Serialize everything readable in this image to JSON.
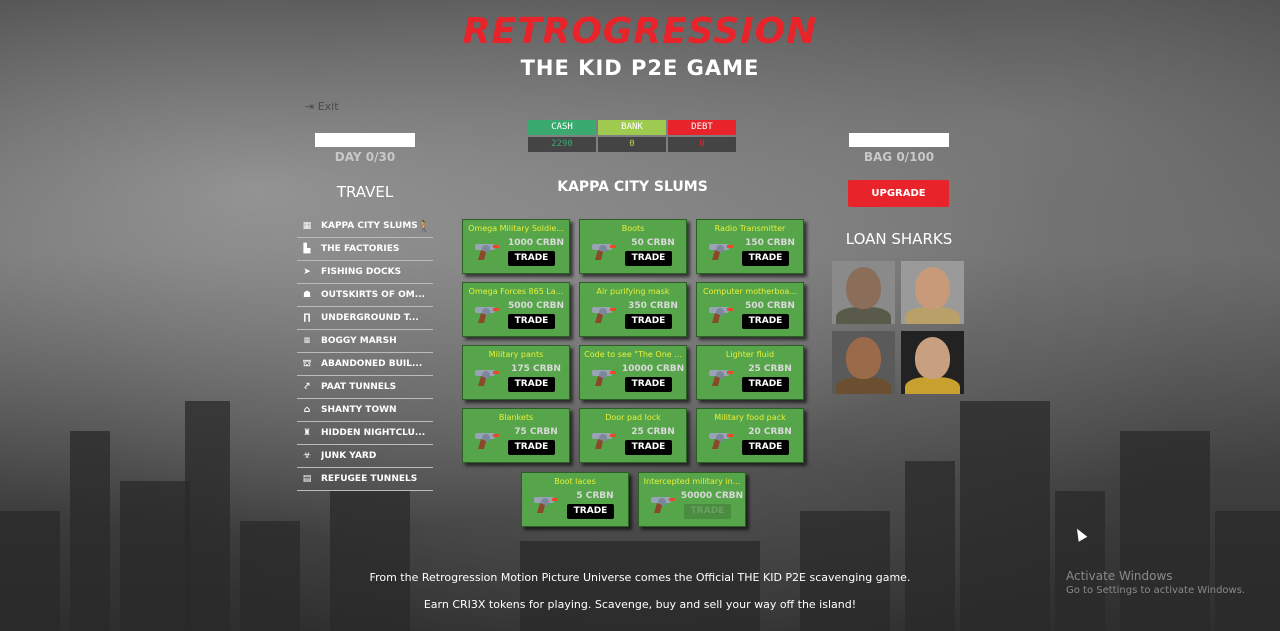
{
  "header": {
    "logo_text": "RETROGRESSION",
    "subtitle": "THE KID P2E GAME"
  },
  "exit_label": "Exit",
  "day": {
    "label": "DAY 0/30",
    "progress": 0
  },
  "bag": {
    "label": "BAG 0/100",
    "progress": 0
  },
  "stats": [
    {
      "label": "CASH",
      "value": "2290",
      "head_color": "#3aaa6e",
      "value_color": "#3aaa6e"
    },
    {
      "label": "BANK",
      "value": "0",
      "head_color": "#9ecb4f",
      "value_color": "#c8d24a"
    },
    {
      "label": "DEBT",
      "value": "0",
      "head_color": "#e8232a",
      "value_color": "#e8232a"
    }
  ],
  "travel": {
    "title": "TRAVEL",
    "items": [
      {
        "label": "KAPPA CITY SLUMS",
        "icon": "building-icon",
        "glyph": "▦",
        "current": true
      },
      {
        "label": "THE FACTORIES",
        "icon": "factory-icon",
        "glyph": "▙",
        "current": false
      },
      {
        "label": "FISHING DOCKS",
        "icon": "fish-icon",
        "glyph": "➤",
        "current": false
      },
      {
        "label": "OUTSKIRTS OF OM...",
        "icon": "people-icon",
        "glyph": "☗",
        "current": false
      },
      {
        "label": "UNDERGROUND T...",
        "icon": "tunnel-icon",
        "glyph": "∏",
        "current": false
      },
      {
        "label": "BOGGY MARSH",
        "icon": "marsh-icon",
        "glyph": "≡",
        "current": false
      },
      {
        "label": "ABANDONED BUIL...",
        "icon": "ruins-icon",
        "glyph": "⛫",
        "current": false
      },
      {
        "label": "PAAT TUNNELS",
        "icon": "route-icon",
        "glyph": "⤤",
        "current": false
      },
      {
        "label": "SHANTY TOWN",
        "icon": "shack-icon",
        "glyph": "⌂",
        "current": false
      },
      {
        "label": "HIDDEN NIGHTCLU...",
        "icon": "cocktail-icon",
        "glyph": "♜",
        "current": false
      },
      {
        "label": "JUNK YARD",
        "icon": "biohazard-icon",
        "glyph": "☣",
        "current": false
      },
      {
        "label": "REFUGEE TUNNELS",
        "icon": "archive-icon",
        "glyph": "▤",
        "current": false
      }
    ]
  },
  "location": {
    "title": "KAPPA CITY SLUMS"
  },
  "trade_label": "TRADE",
  "items": [
    {
      "name": "Omega Military Soldie...",
      "price": "1000 CRBN",
      "disabled": false
    },
    {
      "name": "Boots",
      "price": "50 CRBN",
      "disabled": false
    },
    {
      "name": "Radio Transmitter",
      "price": "150 CRBN",
      "disabled": false
    },
    {
      "name": "Omega Forces 865 La...",
      "price": "5000 CRBN",
      "disabled": false
    },
    {
      "name": "Air purifying mask",
      "price": "350 CRBN",
      "disabled": false
    },
    {
      "name": "Computer motherboa...",
      "price": "500 CRBN",
      "disabled": false
    },
    {
      "name": "Military pants",
      "price": "175 CRBN",
      "disabled": false
    },
    {
      "name": "Code to see \"The One ...",
      "price": "10000 CRBN",
      "disabled": false
    },
    {
      "name": "Lighter fluid",
      "price": "25 CRBN",
      "disabled": false
    },
    {
      "name": "Blankets",
      "price": "75 CRBN",
      "disabled": false
    },
    {
      "name": "Door pad lock",
      "price": "25 CRBN",
      "disabled": false
    },
    {
      "name": "Military food pack",
      "price": "20 CRBN",
      "disabled": false
    },
    {
      "name": "Boot laces",
      "price": "5 CRBN",
      "disabled": false
    },
    {
      "name": "Intercepted military in...",
      "price": "50000 CRBN",
      "disabled": true
    }
  ],
  "upgrade_label": "UPGRADE",
  "loan_sharks": {
    "title": "LOAN SHARKS",
    "portraits": [
      {
        "name": "loan-shark-1",
        "skin": "#8a6e5a",
        "shirt": "#5a5a4a",
        "bg": "#8a8a8a"
      },
      {
        "name": "loan-shark-2",
        "skin": "#c89a7a",
        "shirt": "#b8a068",
        "bg": "#9a9a9a"
      },
      {
        "name": "loan-shark-3",
        "skin": "#9a6a4a",
        "shirt": "#6a5030",
        "bg": "#5a5a5a"
      },
      {
        "name": "loan-shark-4",
        "skin": "#c8a080",
        "shirt": "#c8a030",
        "bg": "#222222"
      }
    ]
  },
  "footer": {
    "line1": "From the Retrogression Motion Picture Universe comes the Official THE KID P2E scavenging game.",
    "line2": "Earn CRI3X tokens for playing. Scavenge, buy and sell your way off the island!"
  },
  "watermark": {
    "title": "Activate Windows",
    "sub": "Go to Settings to activate Windows."
  }
}
